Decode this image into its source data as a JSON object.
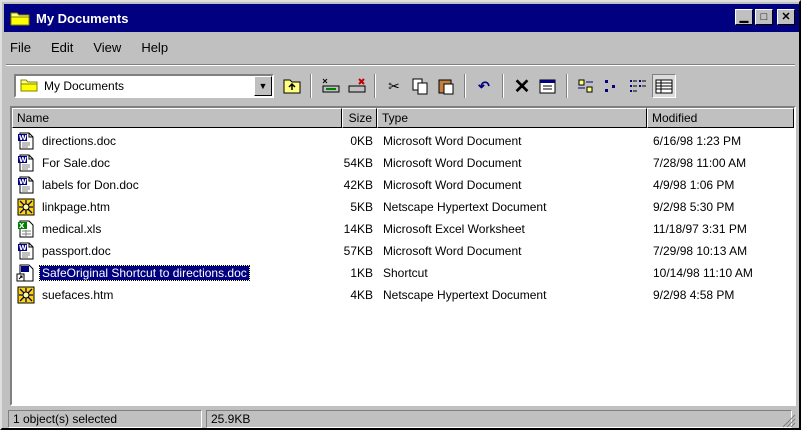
{
  "window": {
    "title": "My Documents",
    "controls": [
      "minimize",
      "maximize",
      "close"
    ]
  },
  "menu": [
    {
      "label": "File"
    },
    {
      "label": "Edit"
    },
    {
      "label": "View"
    },
    {
      "label": "Help"
    }
  ],
  "toolbar": {
    "address_value": "My Documents",
    "buttons": [
      "up-one-level",
      "map-network-drive",
      "disconnect-drive",
      "cut",
      "copy",
      "paste",
      "undo",
      "delete",
      "properties",
      "large-icons",
      "small-icons",
      "list",
      "details"
    ]
  },
  "list": {
    "columns": [
      "Name",
      "Size",
      "Type",
      "Modified"
    ],
    "rows": [
      {
        "name": "directions.doc",
        "size": "0KB",
        "type": "Microsoft Word Document",
        "modified": "6/16/98 1:23 PM",
        "icon": "word-doc-icon"
      },
      {
        "name": "For Sale.doc",
        "size": "54KB",
        "type": "Microsoft Word Document",
        "modified": "7/28/98 11:00 AM",
        "icon": "word-doc-icon"
      },
      {
        "name": "labels for Don.doc",
        "size": "42KB",
        "type": "Microsoft Word Document",
        "modified": "4/9/98 1:06 PM",
        "icon": "word-doc-icon"
      },
      {
        "name": "linkpage.htm",
        "size": "5KB",
        "type": "Netscape Hypertext Document",
        "modified": "9/2/98 5:30 PM",
        "icon": "netscape-htm-icon"
      },
      {
        "name": "medical.xls",
        "size": "14KB",
        "type": "Microsoft Excel Worksheet",
        "modified": "11/18/97 3:31 PM",
        "icon": "excel-xls-icon"
      },
      {
        "name": "passport.doc",
        "size": "57KB",
        "type": "Microsoft Word Document",
        "modified": "7/29/98 10:13 AM",
        "icon": "word-doc-icon"
      },
      {
        "name": "SafeOriginal Shortcut to directions.doc",
        "size": "1KB",
        "type": "Shortcut",
        "modified": "10/14/98 11:10 AM",
        "icon": "shortcut-icon",
        "selected": true
      },
      {
        "name": "suefaces.htm",
        "size": "4KB",
        "type": "Netscape Hypertext Document",
        "modified": "9/2/98 4:58 PM",
        "icon": "netscape-htm-icon"
      }
    ]
  },
  "status": {
    "selection": "1 object(s) selected",
    "size": "25.9KB"
  },
  "colors": {
    "titlebar": "#000080",
    "selection": "#000080",
    "face": "#c0c0c0"
  }
}
